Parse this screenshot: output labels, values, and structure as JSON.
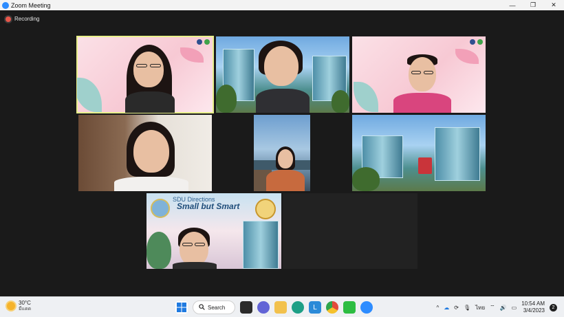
{
  "window": {
    "title": "Zoom Meeting",
    "controls": {
      "minimize": "—",
      "maximize": "❐",
      "close": "✕"
    }
  },
  "meeting": {
    "recording_label": "Recording",
    "tile_sdu": {
      "line1": "SDU Directions",
      "line2": "Small but Smart"
    }
  },
  "taskbar": {
    "weather": {
      "temp": "30°C",
      "condition": "มีแดด"
    },
    "search_label": "Search",
    "lang": "ไทย",
    "time": "10:54 AM",
    "date": "3/4/2023",
    "notifications": "2"
  },
  "colors": {
    "accent": "#2d8cff",
    "active_speaker": "#e8f08a",
    "recording": "#e8564a"
  }
}
